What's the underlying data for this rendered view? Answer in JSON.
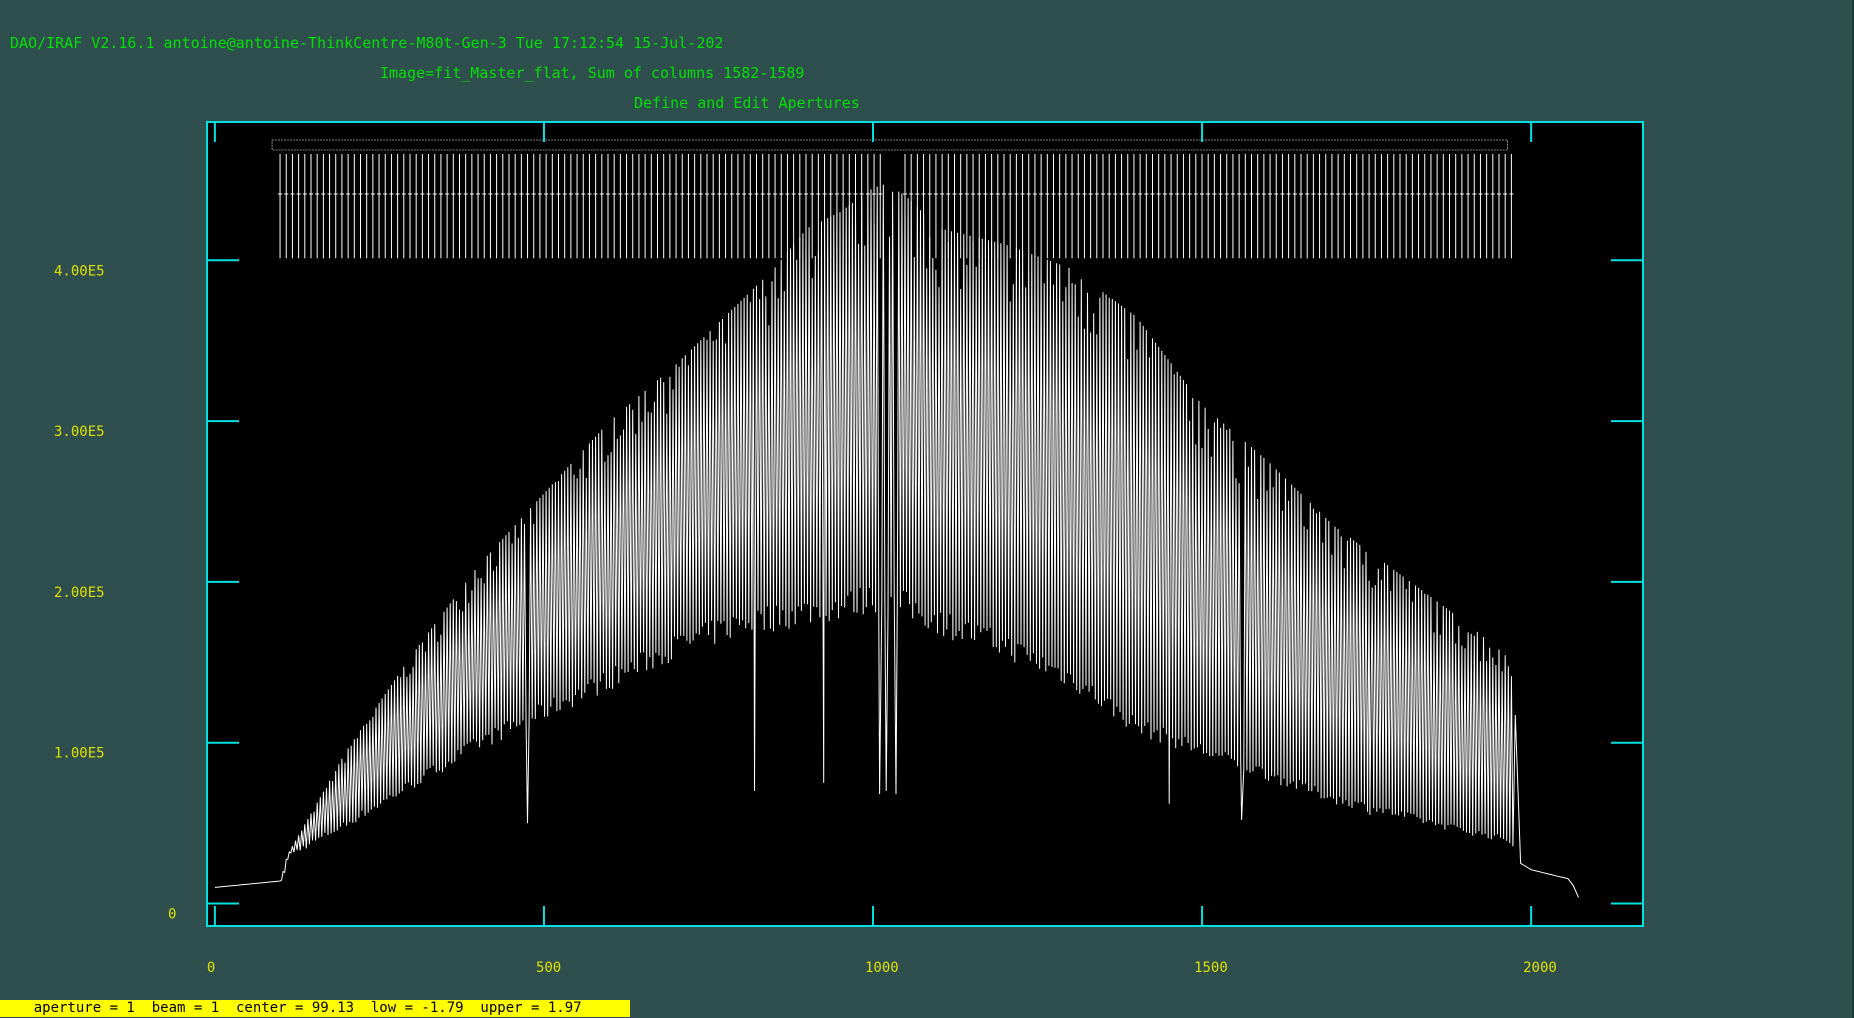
{
  "window": {
    "title_line": "DAO/IRAF V2.16.1 antoine@antoine-ThinkCentre-M80t-Gen-3 Tue 17:12:54 15-Jul-202",
    "subtitle_line": "Image=fit_Master_flat, Sum of columns 1582-1589",
    "mode_line": "Define and Edit Apertures"
  },
  "colors": {
    "background": "#2f4f4f",
    "plot_background": "#000000",
    "frame": "#00e0e0",
    "header_text": "#00e000",
    "tick_label_text": "#e0e000",
    "trace": "#ffffff",
    "status_bar_bg": "#ffff00"
  },
  "status_bar": {
    "text": "    aperture = 1  beam = 1  center = 99.13  low = -1.79  upper = 1.97"
  },
  "chart_data": {
    "type": "line",
    "title": "Define and Edit Apertures",
    "xlabel": "",
    "ylabel": "",
    "xlim": [
      -12,
      2170
    ],
    "ylim": [
      -14000,
      486000
    ],
    "xticks": [
      0,
      500,
      1000,
      1500,
      2000
    ],
    "xtick_labels": [
      "0",
      "500",
      "1000",
      "1500",
      "2000"
    ],
    "yticks": [
      0,
      100000,
      200000,
      300000,
      400000
    ],
    "ytick_labels": [
      "0",
      "1.00E5",
      "2.00E5",
      "3.00E5",
      "4.00E5"
    ],
    "grid": false,
    "aperture_marks": {
      "count": 200,
      "x_start": 99,
      "x_end": 1970,
      "gaps": [
        [
          1015,
          1040
        ]
      ]
    },
    "series": [
      {
        "envelope": {
          "x": [
            0,
            100,
            110,
            200,
            300,
            400,
            500,
            600,
            700,
            800,
            850,
            900,
            950,
            1000,
            1010,
            1050,
            1100,
            1200,
            1300,
            1350,
            1400,
            1500,
            1600,
            1700,
            1800,
            1900,
            1960,
            1975,
            1980,
            2000,
            2060,
            2075
          ],
          "peak": [
            10000,
            14000,
            30000,
            95000,
            155000,
            210000,
            255000,
            300000,
            335000,
            375000,
            395000,
            420000,
            430000,
            445000,
            450000,
            440000,
            420000,
            410000,
            395000,
            380000,
            365000,
            310000,
            275000,
            235000,
            205000,
            175000,
            155000,
            140000,
            26000,
            21000,
            15000,
            1000
          ],
          "trough": [
            10000,
            14000,
            30000,
            50000,
            75000,
            100000,
            120000,
            140000,
            160000,
            175000,
            178000,
            182000,
            185000,
            190000,
            190000,
            185000,
            175000,
            160000,
            140000,
            125000,
            110000,
            95000,
            80000,
            65000,
            55000,
            45000,
            40000,
            35000,
            26000,
            21000,
            15000,
            1000
          ]
        },
        "dips": [
          {
            "x": 475,
            "y": 50000
          },
          {
            "x": 820,
            "y": 70000
          },
          {
            "x": 925,
            "y": 75000
          },
          {
            "x": 1010,
            "y": 68000
          },
          {
            "x": 1020,
            "y": 70000
          },
          {
            "x": 1035,
            "y": 68000
          },
          {
            "x": 1450,
            "y": 62000
          },
          {
            "x": 1560,
            "y": 52000
          },
          {
            "x": 1755,
            "y": 55000
          }
        ]
      }
    ]
  }
}
